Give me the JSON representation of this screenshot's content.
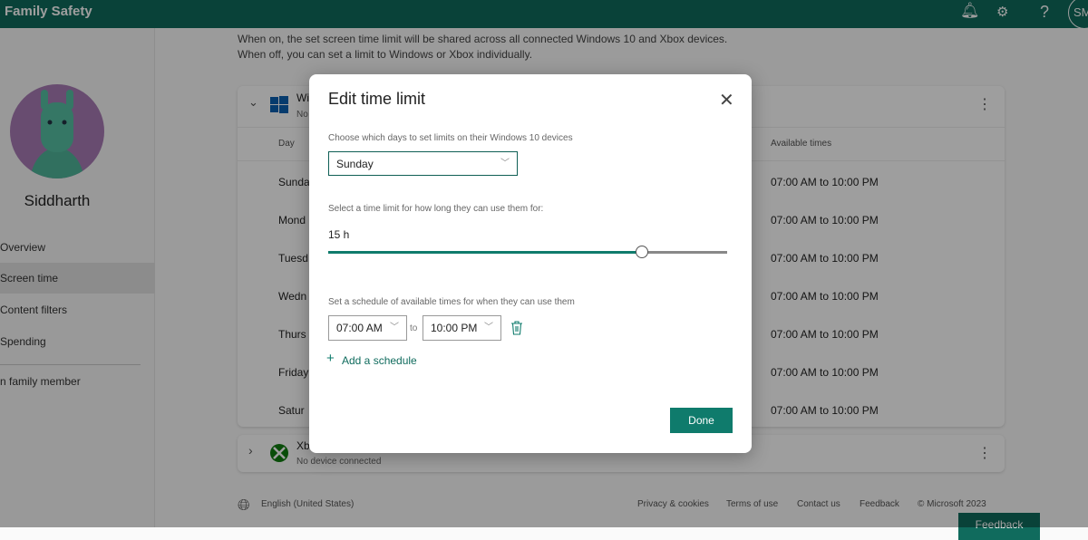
{
  "header": {
    "title": "Family Safety",
    "icons": [
      "bell-icon",
      "family-settings-icon",
      "help-icon"
    ],
    "avatar_initials": "SM"
  },
  "sidebar": {
    "name": "Siddharth",
    "items": [
      {
        "label": "Overview"
      },
      {
        "label": "Screen time",
        "selected": true
      },
      {
        "label": "Content filters"
      },
      {
        "label": "Spending"
      }
    ],
    "add_member": "n family member"
  },
  "main": {
    "intro_line1": "When on, the set screen time limit will be shared across all connected Windows 10 and Xbox devices.",
    "intro_line2": "When off, you can set a limit to Windows or Xbox individually.",
    "windows_card": {
      "title": "Wi",
      "subtitle": "No",
      "col_day": "Day",
      "col_times": "Available times",
      "rows": [
        {
          "day": "Sunda",
          "times": "07:00 AM to 10:00 PM"
        },
        {
          "day": "Mond",
          "times": "07:00 AM to 10:00 PM"
        },
        {
          "day": "Tuesd",
          "times": "07:00 AM to 10:00 PM"
        },
        {
          "day": "Wedn",
          "times": "07:00 AM to 10:00 PM"
        },
        {
          "day": "Thurs",
          "times": "07:00 AM to 10:00 PM"
        },
        {
          "day": "Friday",
          "times": "07:00 AM to 10:00 PM"
        },
        {
          "day": "Satur",
          "times": "07:00 AM to 10:00 PM"
        }
      ]
    },
    "xbox_card": {
      "title": "Xb",
      "subtitle": "No device connected"
    }
  },
  "footer": {
    "language": "English (United States)",
    "links": [
      "Privacy & cookies",
      "Terms of use",
      "Contact us",
      "Feedback"
    ],
    "copyright": "© Microsoft 2023",
    "feedback_button": "Feedback"
  },
  "modal": {
    "title": "Edit time limit",
    "days_label": "Choose which days to set limits on their Windows 10 devices",
    "day_value": "Sunday",
    "limit_label": "Select a time limit for how long they can use them for:",
    "limit_value": "15 h",
    "slider_fraction": 0.786,
    "schedule_label": "Set a schedule of available times for when they can use them",
    "from_value": "07:00 AM",
    "to_label": "to",
    "to_value": "10:00 PM",
    "add_schedule": "Add a schedule",
    "done": "Done"
  },
  "colors": {
    "brand": "#106b5d",
    "accent": "#0f7b6c"
  }
}
